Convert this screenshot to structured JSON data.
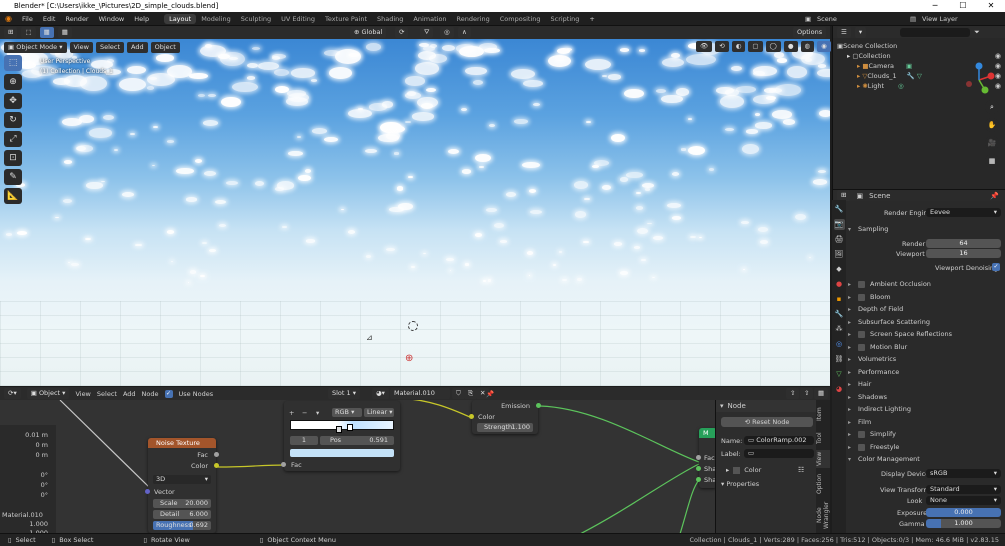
{
  "titlebar": {
    "title": "Blender* [C:\\Users\\ikke_\\Pictures\\2D_simple_clouds.blend]",
    "minimize": "─",
    "maximize": "☐",
    "close": "✕"
  },
  "menubar": {
    "menus": [
      "File",
      "Edit",
      "Render",
      "Window",
      "Help"
    ],
    "workspaces": [
      "Layout",
      "Modeling",
      "Sculpting",
      "UV Editing",
      "Texture Paint",
      "Shading",
      "Animation",
      "Rendering",
      "Compositing",
      "Scripting"
    ],
    "active_workspace": "Layout",
    "scene": "Scene",
    "view_layer": "View Layer"
  },
  "viewport": {
    "mode": "Object Mode",
    "menus": [
      "View",
      "Select",
      "Add",
      "Object"
    ],
    "transform": "Global",
    "options": "Options",
    "label1": "User Perspective",
    "label2": "(1) Collection | Clouds_1"
  },
  "outliner": {
    "root": "Scene Collection",
    "collection": "Collection",
    "items": [
      "Camera",
      "Clouds_1",
      "Light"
    ]
  },
  "properties": {
    "scene_label": "Scene",
    "render_engine_label": "Render Engine",
    "render_engine": "Eevee",
    "sampling": "Sampling",
    "render_label": "Render",
    "render_val": "64",
    "viewport_label": "Viewport",
    "viewport_val": "16",
    "denoise": "Viewport Denoising",
    "panels": [
      "Ambient Occlusion",
      "Bloom",
      "Depth of Field",
      "Subsurface Scattering",
      "Screen Space Reflections",
      "Motion Blur",
      "Volumetrics",
      "Performance",
      "Hair",
      "Shadows",
      "Indirect Lighting",
      "Film",
      "Simplify",
      "Freestyle",
      "Color Management"
    ],
    "display_device_label": "Display Device",
    "display_device": "sRGB",
    "view_transform_label": "View Transform",
    "view_transform": "Standard",
    "look_label": "Look",
    "look": "None",
    "exposure_label": "Exposure",
    "exposure": "0.000",
    "gamma_label": "Gamma",
    "gamma": "1.000"
  },
  "node_editor": {
    "editor": "Object",
    "menus": [
      "View",
      "Select",
      "Add",
      "Node"
    ],
    "use_nodes": "Use Nodes",
    "slot": "Slot 1",
    "material": "Material.010",
    "ramp": {
      "mode": "RGB",
      "interp": "Linear",
      "index": "1",
      "pos_label": "Pos",
      "pos": "0.591",
      "fac": "Fac",
      "plus": "+",
      "minus": "−"
    },
    "noise": {
      "title": "Noise Texture",
      "fac": "Fac",
      "color": "Color",
      "dim": "3D",
      "vector": "Vector",
      "scale_label": "Scale",
      "scale": "20.000",
      "detail_label": "Detail",
      "detail": "6.000",
      "rough_label": "Roughness",
      "rough": "0.692"
    },
    "emission": {
      "title": "Emission",
      "color": "Color",
      "strength_label": "Strength",
      "strength": "1.100"
    },
    "mix": {
      "title": "M",
      "fac": "Fac",
      "sh1": "Sha",
      "sh2": "Sha"
    },
    "left_values": [
      "0.01 m",
      "0 m",
      "0 m",
      "0°",
      "0°",
      "0°",
      "Material.010",
      "1.000",
      "1.000"
    ],
    "npanel": {
      "section": "Node",
      "reset": "Reset Node",
      "name_label": "Name:",
      "name": "ColorRamp.002",
      "label_label": "Label:",
      "color": "Color",
      "properties": "Properties"
    },
    "tabs": [
      "Item",
      "Tool",
      "View",
      "Option",
      "Node Wrangler"
    ]
  },
  "statusbar": {
    "select": "Select",
    "box_select": "Box Select",
    "rotate": "Rotate View",
    "context": "Object Context Menu",
    "stats": "Collection | Clouds_1 | Verts:289 | Faces:256 | Tris:512 | Objects:0/3 | Mem: 46.6 MiB | v2.83.15"
  }
}
